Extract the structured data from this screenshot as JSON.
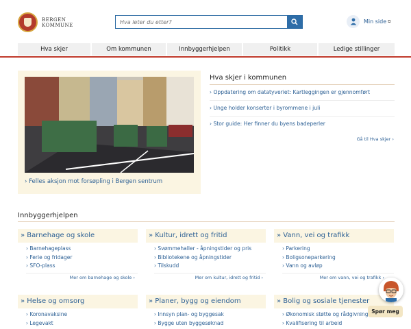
{
  "header": {
    "logo_line1": "BERGEN",
    "logo_line2": "KOMMUNE",
    "search_placeholder": "Hva leter du etter?",
    "my_page_label": "Min side"
  },
  "nav": {
    "items": [
      "Hva skjer",
      "Om kommunen",
      "Innbyggerhjelpen",
      "Politikk",
      "Ledige stillinger"
    ]
  },
  "featured": {
    "link": "Felles aksjon mot forsøpling i Bergen sentrum"
  },
  "news": {
    "title": "Hva skjer i kommunen",
    "items": [
      "Oppdatering om datatyveriet: Kartleggingen er gjennomført",
      "Unge holder konserter i byrommene i juli",
      "Stor guide: Her finner du byens badeperler"
    ],
    "more": "Gå til Hva skjer"
  },
  "innbygger": {
    "title": "Innbyggerhjelpen",
    "cards": [
      {
        "title": "Barnehage og skole",
        "links": [
          "Barnehageplass",
          "Ferie og fridager",
          "SFO-plass"
        ],
        "more": "Mer om barnehage og skole"
      },
      {
        "title": "Kultur, idrett og fritid",
        "links": [
          "Svømmehaller - åpningstider og pris",
          "Bibliotekene og åpningstider",
          "Tilskudd"
        ],
        "more": "Mer om kultur, idrett og fritid"
      },
      {
        "title": "Vann, vei og trafikk",
        "links": [
          "Parkering",
          "Boligsoneparkering",
          "Vann og avløp"
        ],
        "more": "Mer om vann, vei og trafikk"
      },
      {
        "title": "Helse og omsorg",
        "links": [
          "Koronavaksine",
          "Legevakt"
        ]
      },
      {
        "title": "Planer, bygg og eiendom",
        "links": [
          "Innsyn plan- og byggesak",
          "Bygge uten byggesøknad"
        ]
      },
      {
        "title": "Bolig og sosiale tjenester",
        "links": [
          "Økonomisk støtte og rådgivning",
          "Kvalifisering til arbeid"
        ]
      }
    ]
  },
  "chat": {
    "label": "Spør meg"
  },
  "colors": {
    "brand_red": "#c0392b",
    "link_blue": "#2b5f94",
    "card_beige": "#fbf5e2"
  }
}
